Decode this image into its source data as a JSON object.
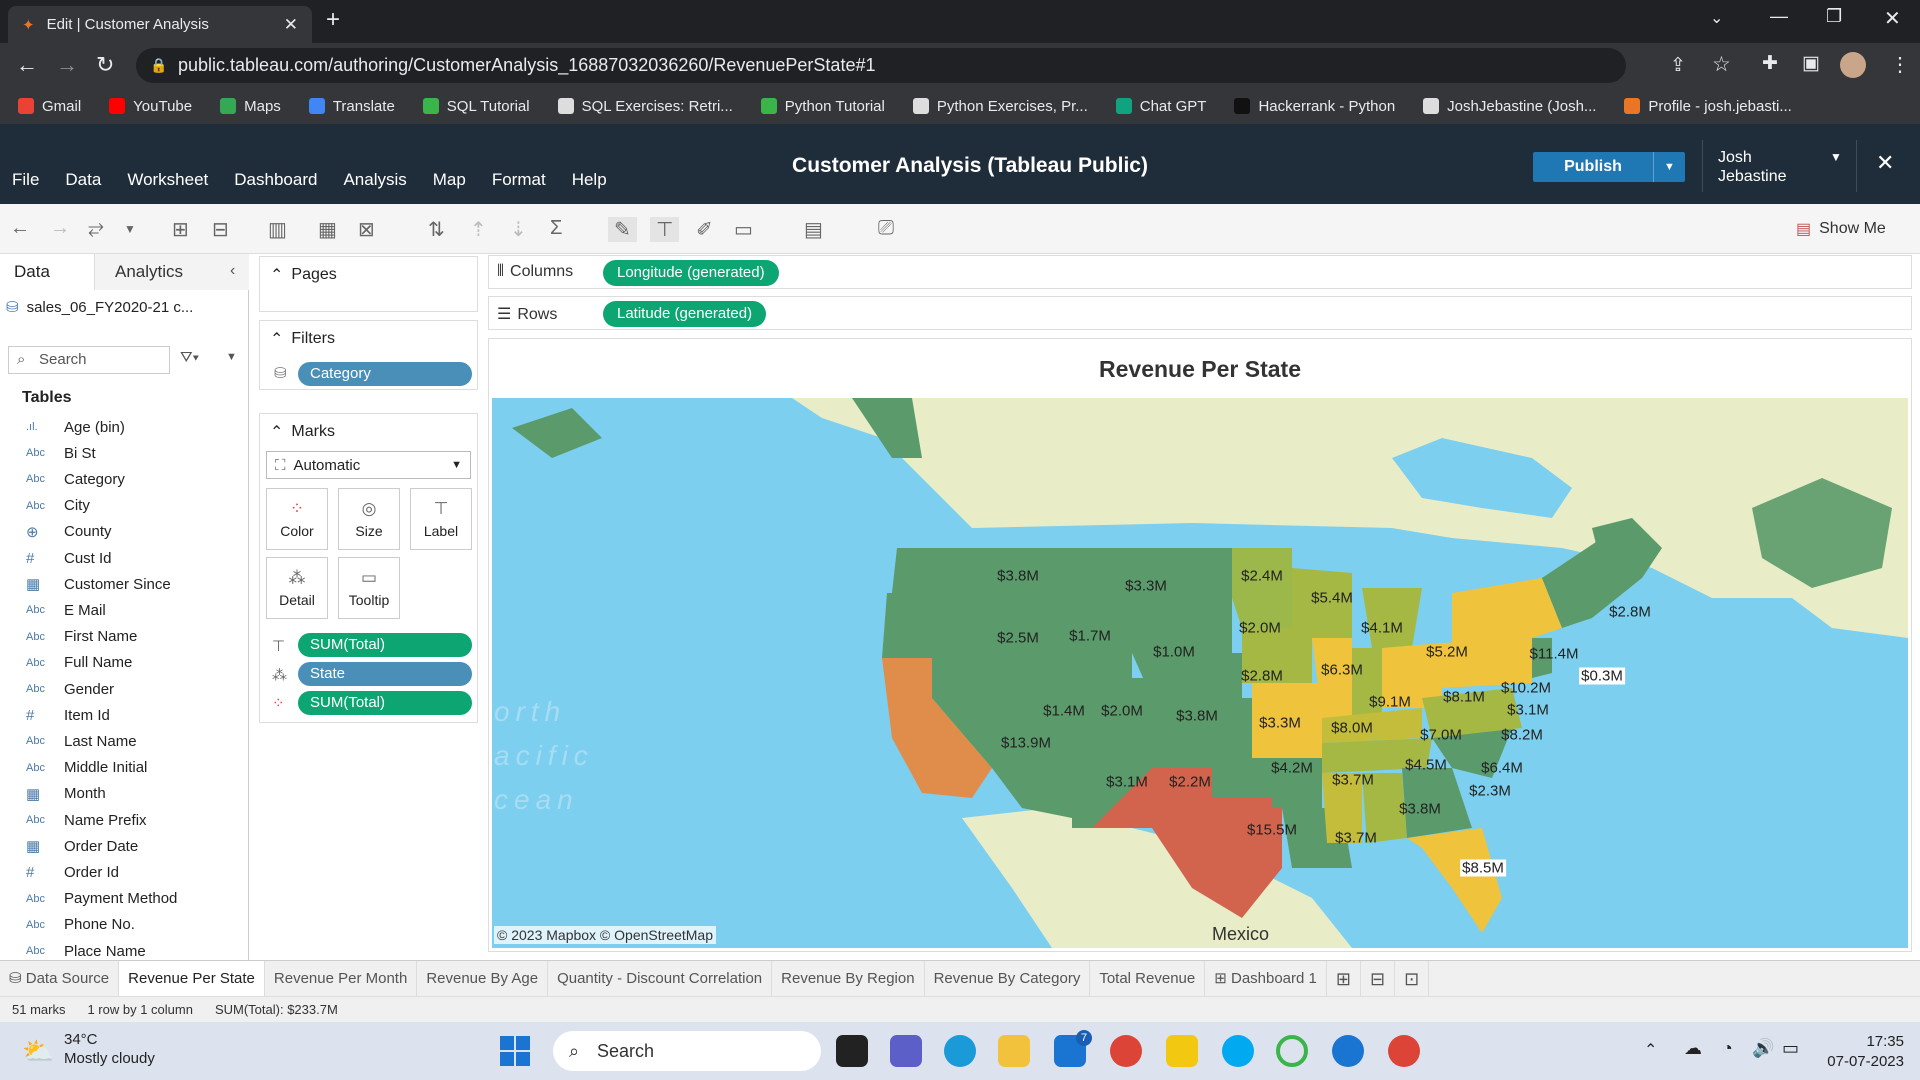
{
  "browser": {
    "tab_title": "Edit | Customer Analysis",
    "url": "public.tableau.com/authoring/CustomerAnalysis_16887032036260/RevenuePerState#1",
    "bookmarks": [
      "Gmail",
      "YouTube",
      "Maps",
      "Translate",
      "SQL Tutorial",
      "SQL Exercises: Retri...",
      "Python Tutorial",
      "Python Exercises, Pr...",
      "Chat GPT",
      "Hackerrank - Python",
      "JoshJebastine (Josh...",
      "Profile - josh.jebasti..."
    ]
  },
  "header": {
    "menus": [
      "File",
      "Data",
      "Worksheet",
      "Dashboard",
      "Analysis",
      "Map",
      "Format",
      "Help"
    ],
    "title": "Customer Analysis (Tableau Public)",
    "publish_label": "Publish",
    "user_first": "Josh",
    "user_last": "Jebastine",
    "show_me": "Show Me"
  },
  "data_pane": {
    "tab_data": "Data",
    "tab_analytics": "Analytics",
    "datasource": "sales_06_FY2020-21 c...",
    "search_placeholder": "Search",
    "tables_header": "Tables",
    "fields": [
      {
        "type": "bin",
        "name": "Age (bin)"
      },
      {
        "type": "Abc",
        "name": "Bi St"
      },
      {
        "type": "Abc",
        "name": "Category"
      },
      {
        "type": "Abc",
        "name": "City"
      },
      {
        "type": "geo",
        "name": "County"
      },
      {
        "type": "#",
        "name": "Cust Id"
      },
      {
        "type": "date",
        "name": "Customer Since"
      },
      {
        "type": "Abc",
        "name": "E Mail"
      },
      {
        "type": "Abc",
        "name": "First Name"
      },
      {
        "type": "Abc",
        "name": "Full Name"
      },
      {
        "type": "Abc",
        "name": "Gender"
      },
      {
        "type": "#",
        "name": "Item Id"
      },
      {
        "type": "Abc",
        "name": "Last Name"
      },
      {
        "type": "Abc",
        "name": "Middle Initial"
      },
      {
        "type": "date",
        "name": "Month"
      },
      {
        "type": "Abc",
        "name": "Name Prefix"
      },
      {
        "type": "date",
        "name": "Order Date"
      },
      {
        "type": "#",
        "name": "Order Id"
      },
      {
        "type": "Abc",
        "name": "Payment Method"
      },
      {
        "type": "Abc",
        "name": "Phone No."
      },
      {
        "type": "Abc",
        "name": "Place Name"
      }
    ]
  },
  "shelves": {
    "pages": "Pages",
    "filters": "Filters",
    "filter_pill": "Category",
    "marks": "Marks",
    "mark_type": "Automatic",
    "mark_buttons": [
      "Color",
      "Size",
      "Label",
      "Detail",
      "Tooltip"
    ],
    "mark_pills": [
      "SUM(Total)",
      "State",
      "SUM(Total)"
    ],
    "columns_label": "Columns",
    "columns_pill": "Longitude (generated)",
    "rows_label": "Rows",
    "rows_pill": "Latitude (generated)"
  },
  "view": {
    "title": "Revenue Per State",
    "attribution": "© 2023 Mapbox © OpenStreetMap",
    "ocean_lines": [
      "orth",
      "acific",
      "cean"
    ],
    "country_label": "Mexico",
    "state_revenue": [
      {
        "label": "$3.8M"
      },
      {
        "label": "$3.3M"
      },
      {
        "label": "$2.4M"
      },
      {
        "label": "$5.4M"
      },
      {
        "label": "$2.8M"
      },
      {
        "label": "$2.5M"
      },
      {
        "label": "$1.7M"
      },
      {
        "label": "$1.0M"
      },
      {
        "label": "$2.0M"
      },
      {
        "label": "$4.1M"
      },
      {
        "label": "$5.2M"
      },
      {
        "label": "$11.4M"
      },
      {
        "label": "$0.3M"
      },
      {
        "label": "$6.3M"
      },
      {
        "label": "$2.8M"
      },
      {
        "label": "$9.1M"
      },
      {
        "label": "$8.1M"
      },
      {
        "label": "$10.2M"
      },
      {
        "label": "$3.1M"
      },
      {
        "label": "$1.4M"
      },
      {
        "label": "$2.0M"
      },
      {
        "label": "$3.8M"
      },
      {
        "label": "$3.3M"
      },
      {
        "label": "$8.0M"
      },
      {
        "label": "$7.0M"
      },
      {
        "label": "$8.2M"
      },
      {
        "label": "$13.9M"
      },
      {
        "label": "$4.5M"
      },
      {
        "label": "$6.4M"
      },
      {
        "label": "$4.2M"
      },
      {
        "label": "$3.1M"
      },
      {
        "label": "$2.2M"
      },
      {
        "label": "$3.7M"
      },
      {
        "label": "$2.3M"
      },
      {
        "label": "$3.8M"
      },
      {
        "label": "$15.5M"
      },
      {
        "label": "$3.7M"
      },
      {
        "label": "$8.5M"
      }
    ]
  },
  "sheet_tabs": [
    "Data Source",
    "Revenue Per State",
    "Revenue Per Month",
    "Revenue By Age",
    "Quantity - Discount Correlation",
    "Revenue By Region",
    "Revenue By Category",
    "Total Revenue",
    "Dashboard 1"
  ],
  "status": {
    "marks": "51 marks",
    "dims": "1 row by 1 column",
    "sum": "SUM(Total): $233.7M"
  },
  "taskbar": {
    "temp": "34°C",
    "weather": "Mostly cloudy",
    "search": "Search",
    "time": "17:35",
    "date": "07-07-2023",
    "mail_badge": "7"
  },
  "colors": {
    "low": "#5b9a6a",
    "mid": "#a5b844",
    "high": "#f0c33c",
    "orange": "#e08d4b",
    "red": "#d2644d",
    "ocean": "#7ccfee",
    "land": "#e8edc8"
  }
}
